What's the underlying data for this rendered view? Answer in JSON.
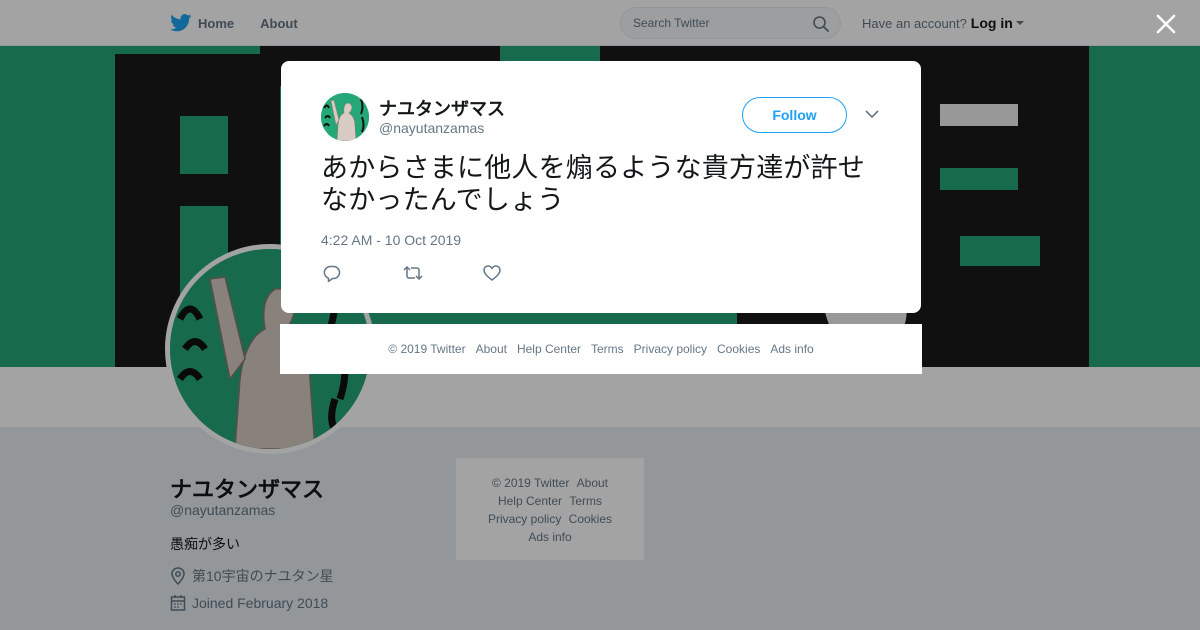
{
  "topbar": {
    "home_label": "Home",
    "about_label": "About",
    "search_placeholder": "Search Twitter",
    "have_account": "Have an account?",
    "login_label": "Log in"
  },
  "profile": {
    "name": "ナユタンザマス",
    "handle": "@nayutanzamas",
    "bio": "愚痴が多い",
    "location": "第10宇宙のナユタン星",
    "joined": "Joined February 2018"
  },
  "side_footer": {
    "links": [
      "© 2019 Twitter",
      "About",
      "Help Center",
      "Terms",
      "Privacy policy",
      "Cookies",
      "Ads info"
    ]
  },
  "tweet": {
    "name": "ナユタンザマス",
    "handle": "@nayutanzamas",
    "follow_label": "Follow",
    "text": "あからさまに他人を煽るような貴方達が許せなかったんでしょう",
    "timestamp": "4:22 AM - 10 Oct 2019"
  },
  "modal_footer": {
    "links": [
      "© 2019 Twitter",
      "About",
      "Help Center",
      "Terms",
      "Privacy policy",
      "Cookies",
      "Ads info"
    ]
  },
  "colors": {
    "accent": "#1da1f2",
    "banner_green": "#25a877",
    "text_secondary": "#657786"
  },
  "icons": [
    "twitter-bird-icon",
    "search-icon",
    "location-icon",
    "calendar-icon",
    "close-icon",
    "chevron-down-icon",
    "reply-icon",
    "retweet-icon",
    "like-icon"
  ]
}
